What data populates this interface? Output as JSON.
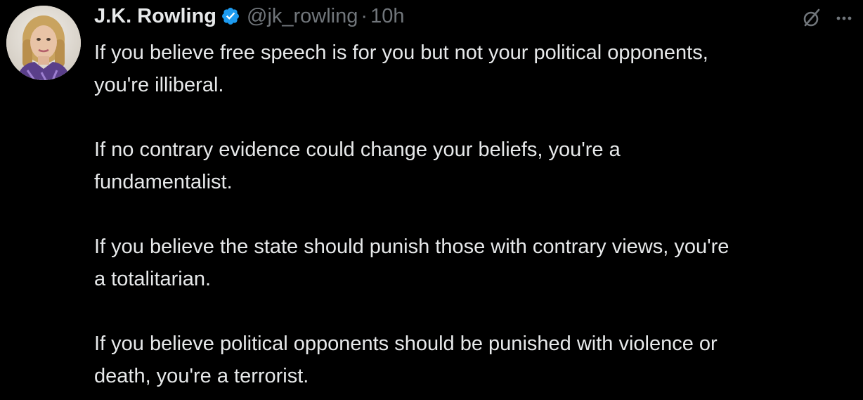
{
  "tweet": {
    "author": {
      "display_name": "J.K. Rowling",
      "handle": "@jk_rowling",
      "verified": true,
      "verified_color": "#1d9bf0"
    },
    "separator": "·",
    "timestamp": "10h",
    "icons": {
      "grok": "grok-slash-icon",
      "more": "more-dots-icon"
    },
    "paragraphs": [
      {
        "line1": "If you believe free speech is for you but not your political opponents,",
        "line2": "you're illiberal."
      },
      {
        "line1": "If no contrary evidence could change your beliefs, you're a",
        "line2": "fundamentalist."
      },
      {
        "line1": "If you believe the state should punish those with contrary views, you're",
        "line2": "a totalitarian."
      },
      {
        "line1": "If you believe political opponents should be punished with violence or",
        "line2": "death, you're a terrorist."
      }
    ]
  },
  "colors": {
    "background": "#000000",
    "primary_text": "#e7e9ea",
    "secondary_text": "#71767b",
    "accent": "#1d9bf0"
  }
}
